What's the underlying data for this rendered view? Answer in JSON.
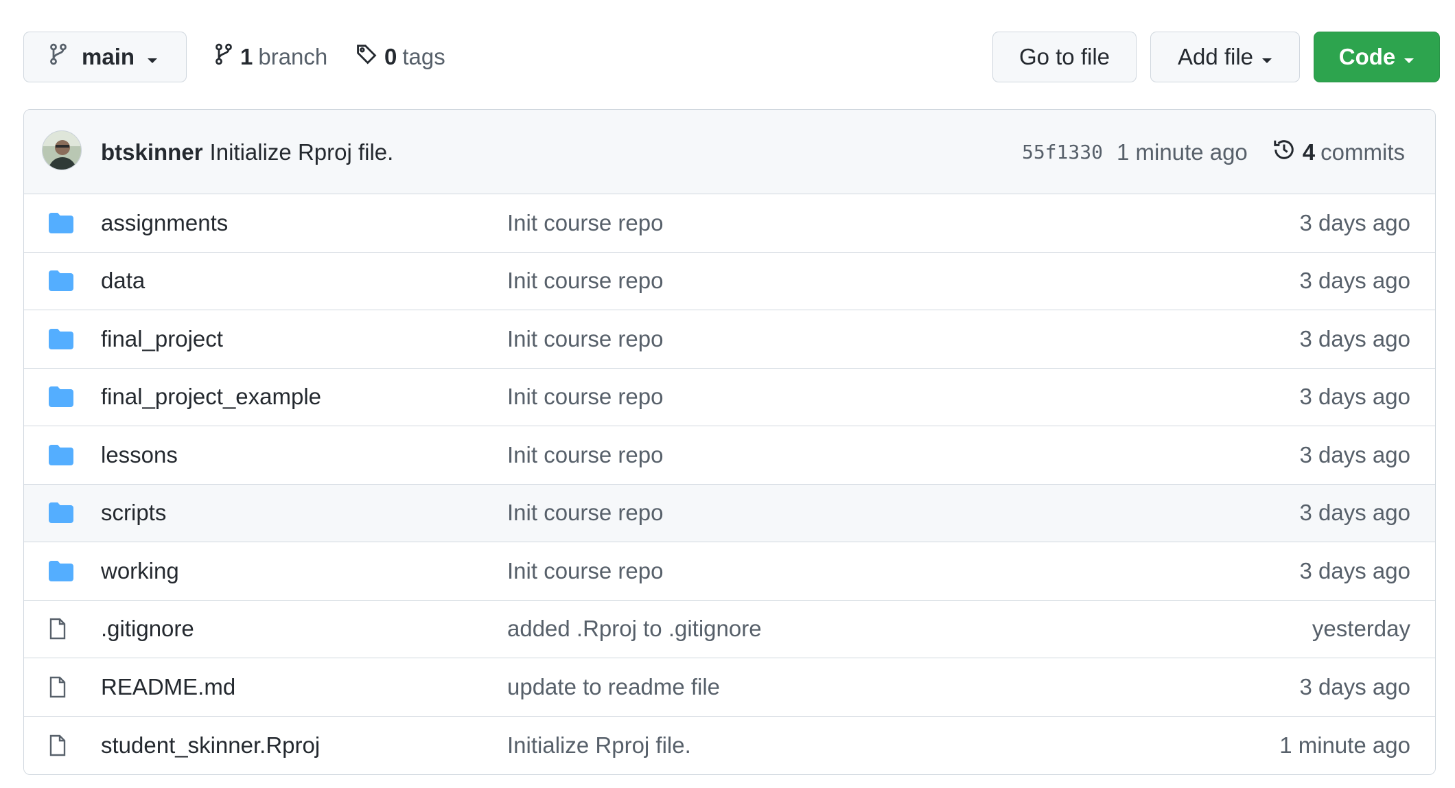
{
  "toolbar": {
    "branch_name": "main",
    "branch_count": "1",
    "branch_label": "branch",
    "tag_count": "0",
    "tag_label": "tags",
    "go_to_file": "Go to file",
    "add_file": "Add file",
    "code": "Code"
  },
  "latest_commit": {
    "author": "btskinner",
    "message": "Initialize Rproj file.",
    "sha": "55f1330",
    "time": "1 minute ago",
    "commit_count": "4",
    "commit_label": "commits"
  },
  "files": [
    {
      "type": "folder-icon",
      "name": "assignments",
      "message": "Init course repo",
      "age": "3 days ago"
    },
    {
      "type": "folder-icon",
      "name": "data",
      "message": "Init course repo",
      "age": "3 days ago"
    },
    {
      "type": "folder-icon",
      "name": "final_project",
      "message": "Init course repo",
      "age": "3 days ago"
    },
    {
      "type": "folder-icon",
      "name": "final_project_example",
      "message": "Init course repo",
      "age": "3 days ago"
    },
    {
      "type": "folder-icon",
      "name": "lessons",
      "message": "Init course repo",
      "age": "3 days ago"
    },
    {
      "type": "folder-icon",
      "name": "scripts",
      "message": "Init course repo",
      "age": "3 days ago"
    },
    {
      "type": "folder-icon",
      "name": "working",
      "message": "Init course repo",
      "age": "3 days ago"
    },
    {
      "type": "file-icon",
      "name": ".gitignore",
      "message": "added .Rproj to .gitignore",
      "age": "yesterday"
    },
    {
      "type": "file-icon",
      "name": "README.md",
      "message": "update to readme file",
      "age": "3 days ago"
    },
    {
      "type": "file-icon",
      "name": "student_skinner.Rproj",
      "message": "Initialize Rproj file.",
      "age": "1 minute ago"
    }
  ],
  "colors": {
    "folder": "#54aeff",
    "code_button": "#2da44e",
    "hover_row": "#f6f8fa"
  }
}
